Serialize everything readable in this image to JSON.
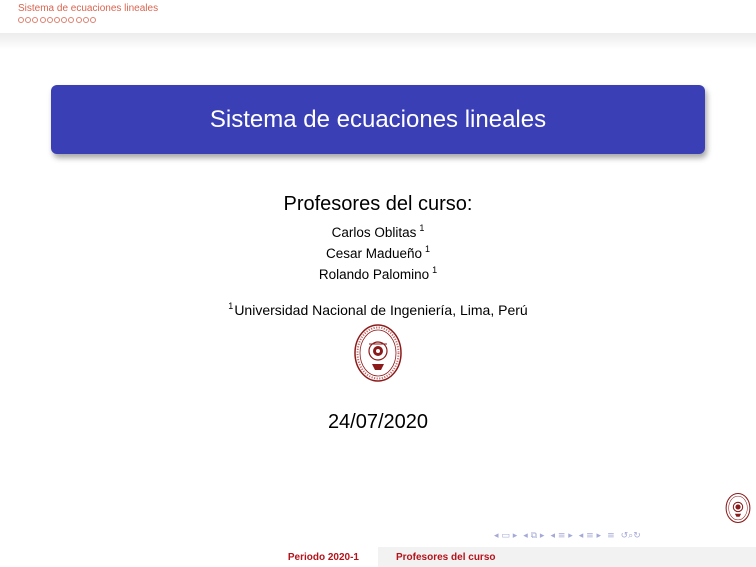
{
  "header": {
    "section_title": "Sistema de ecuaciones lineales",
    "frame_dot_count": 11
  },
  "title": "Sistema de ecuaciones lineales",
  "professors": {
    "heading": "Profesores del curso:",
    "names": [
      "Carlos Oblitas",
      "Cesar Madueño",
      "Rolando Palomino"
    ],
    "affiliation_mark": "1"
  },
  "institute": {
    "mark": "1",
    "name": "Universidad Nacional de Ingeniería, Lima, Perú"
  },
  "date": "24/07/2020",
  "footer": {
    "left": "Periodo 2020-1",
    "right": "Profesores del curso"
  },
  "colors": {
    "title_box": "#3a3fb6",
    "accent_red": "#b5121b",
    "nav_blue": "#a5a9d8"
  },
  "icons": {
    "seal": "uni-seal-icon",
    "nav": [
      "nav-first-icon",
      "nav-frame-icon",
      "nav-prev-icon",
      "nav-section-icon",
      "nav-subsection-icon",
      "nav-appendix-icon",
      "nav-find-icon"
    ]
  }
}
